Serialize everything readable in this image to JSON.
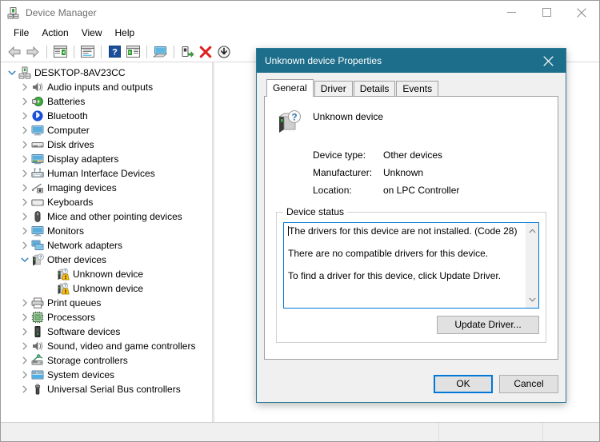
{
  "window": {
    "title": "Device Manager",
    "icon": "device-manager-icon",
    "minimize_label": "Minimize",
    "maximize_label": "Maximize",
    "close_label": "Close"
  },
  "menu": {
    "items": [
      {
        "label": "File"
      },
      {
        "label": "Action"
      },
      {
        "label": "View"
      },
      {
        "label": "Help"
      }
    ]
  },
  "toolbar": {
    "buttons": [
      {
        "name": "back-icon",
        "label": "Back"
      },
      {
        "name": "forward-icon",
        "label": "Forward"
      },
      {
        "name": "show-hide-console-tree-icon",
        "label": "Show/Hide Console Tree"
      },
      {
        "name": "properties-icon",
        "label": "Properties"
      },
      {
        "name": "help-icon",
        "label": "Help"
      },
      {
        "name": "update-driver-icon",
        "label": "Update Driver Software"
      },
      {
        "name": "scan-for-hardware-changes-icon",
        "label": "Scan for hardware changes"
      },
      {
        "name": "enable-device-icon",
        "label": "Enable device"
      },
      {
        "name": "uninstall-device-icon",
        "label": "Uninstall device"
      },
      {
        "name": "disable-device-icon",
        "label": "Disable device"
      }
    ]
  },
  "tree": {
    "nodes": [
      {
        "label": "DESKTOP-8AV23CC",
        "level": 0,
        "state": "expanded",
        "icon": "computer-root-icon"
      },
      {
        "label": "Audio inputs and outputs",
        "level": 1,
        "state": "collapsed",
        "icon": "speaker-icon"
      },
      {
        "label": "Batteries",
        "level": 1,
        "state": "collapsed",
        "icon": "battery-icon"
      },
      {
        "label": "Bluetooth",
        "level": 1,
        "state": "collapsed",
        "icon": "bluetooth-icon"
      },
      {
        "label": "Computer",
        "level": 1,
        "state": "collapsed",
        "icon": "monitor-icon"
      },
      {
        "label": "Disk drives",
        "level": 1,
        "state": "collapsed",
        "icon": "disk-drive-icon"
      },
      {
        "label": "Display adapters",
        "level": 1,
        "state": "collapsed",
        "icon": "display-adapter-icon"
      },
      {
        "label": "Human Interface Devices",
        "level": 1,
        "state": "collapsed",
        "icon": "hid-icon"
      },
      {
        "label": "Imaging devices",
        "level": 1,
        "state": "collapsed",
        "icon": "camera-icon"
      },
      {
        "label": "Keyboards",
        "level": 1,
        "state": "collapsed",
        "icon": "keyboard-icon"
      },
      {
        "label": "Mice and other pointing devices",
        "level": 1,
        "state": "collapsed",
        "icon": "mouse-icon"
      },
      {
        "label": "Monitors",
        "level": 1,
        "state": "collapsed",
        "icon": "monitor-icon"
      },
      {
        "label": "Network adapters",
        "level": 1,
        "state": "collapsed",
        "icon": "network-adapter-icon"
      },
      {
        "label": "Other devices",
        "level": 1,
        "state": "expanded",
        "icon": "other-device-icon"
      },
      {
        "label": "Unknown device",
        "level": 2,
        "state": "leaf",
        "icon": "unknown-device-warning-icon"
      },
      {
        "label": "Unknown device",
        "level": 2,
        "state": "leaf",
        "icon": "unknown-device-warning-icon"
      },
      {
        "label": "Print queues",
        "level": 1,
        "state": "collapsed",
        "icon": "printer-icon"
      },
      {
        "label": "Processors",
        "level": 1,
        "state": "collapsed",
        "icon": "processor-icon"
      },
      {
        "label": "Software devices",
        "level": 1,
        "state": "collapsed",
        "icon": "software-device-icon"
      },
      {
        "label": "Sound, video and game controllers",
        "level": 1,
        "state": "collapsed",
        "icon": "speaker-icon"
      },
      {
        "label": "Storage controllers",
        "level": 1,
        "state": "collapsed",
        "icon": "storage-controller-icon"
      },
      {
        "label": "System devices",
        "level": 1,
        "state": "collapsed",
        "icon": "system-device-icon"
      },
      {
        "label": "Universal Serial Bus controllers",
        "level": 1,
        "state": "collapsed",
        "icon": "usb-icon"
      }
    ]
  },
  "statusbar": {
    "text": ""
  },
  "dialog": {
    "title": "Unknown device Properties",
    "close_label": "Close",
    "tabs": [
      {
        "label": "General",
        "active": true
      },
      {
        "label": "Driver",
        "active": false
      },
      {
        "label": "Details",
        "active": false
      },
      {
        "label": "Events",
        "active": false
      }
    ],
    "device": {
      "icon": "unknown-device-question-icon",
      "name": "Unknown device",
      "properties": [
        {
          "key": "Device type:",
          "value": "Other devices"
        },
        {
          "key": "Manufacturer:",
          "value": "Unknown"
        },
        {
          "key": "Location:",
          "value": "on LPC Controller"
        }
      ]
    },
    "device_status": {
      "legend": "Device status",
      "lines": [
        "The drivers for this device are not installed. (Code 28)",
        "There are no compatible drivers for this device.",
        "",
        "To find a driver for this device, click Update Driver."
      ],
      "scroll_up_label": "Scroll up",
      "scroll_down_label": "Scroll down"
    },
    "update_driver_button": "Update Driver...",
    "ok_button": "OK",
    "cancel_button": "Cancel"
  },
  "colors": {
    "dialog_titlebar": "#1d6e8b",
    "focus_blue": "#0078d7",
    "window_bg": "#ffffff",
    "dialog_bg": "#f0f0f0",
    "statusbar_bg": "#f0f0f0",
    "warning_yellow": "#ffc20e",
    "title_text": "#6d6d6d"
  }
}
